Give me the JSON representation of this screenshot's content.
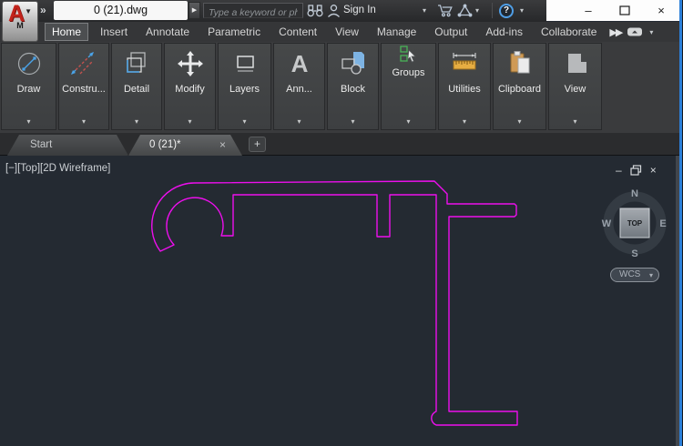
{
  "title_bar": {
    "app_menu_letter": "A",
    "app_menu_modifier": "M",
    "filename": "0 (21).dwg",
    "search_placeholder": "Type a keyword or phrase",
    "sign_in_label": "Sign In",
    "help_glyph": "?"
  },
  "icons": {
    "caret": "▾",
    "overflow": "»",
    "expand": "▶",
    "minimize": "–",
    "close": "×",
    "plus": "+",
    "annotate_glyph": "A"
  },
  "ribbon": {
    "tabs": [
      "Home",
      "Insert",
      "Annotate",
      "Parametric",
      "Content",
      "View",
      "Manage",
      "Output",
      "Add-ins",
      "Collaborate"
    ],
    "active_tab": "Home",
    "panels": [
      {
        "label": "Draw"
      },
      {
        "label": "Constru..."
      },
      {
        "label": "Detail"
      },
      {
        "label": "Modify"
      },
      {
        "label": "Layers"
      },
      {
        "label": "Ann..."
      },
      {
        "label": "Block"
      },
      {
        "label": "Groups"
      },
      {
        "label": "Utilities"
      },
      {
        "label": "Clipboard"
      },
      {
        "label": "View"
      }
    ]
  },
  "file_tabs": {
    "start_label": "Start",
    "document_label": "0 (21)*"
  },
  "viewport": {
    "pane_menu": "[−]",
    "view_name": "[Top]",
    "visual_style": "[2D Wireframe]",
    "viewcube": {
      "north": "N",
      "south": "S",
      "east": "E",
      "west": "W",
      "face": "TOP"
    },
    "ucs_label": "WCS"
  },
  "canvas": {
    "line_color": "#ed0fed",
    "background": "#242a32"
  }
}
